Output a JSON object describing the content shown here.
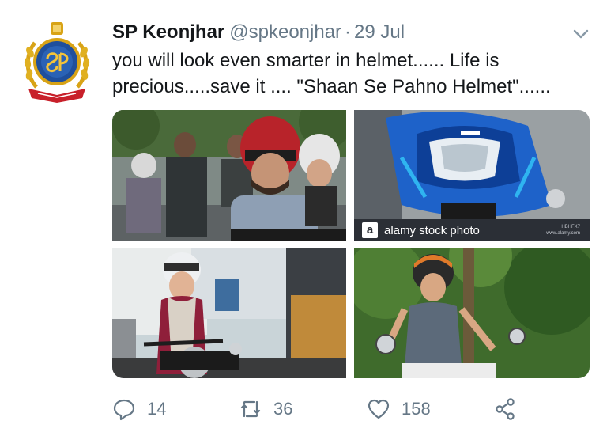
{
  "tweet": {
    "display_name": "SP Keonjhar",
    "handle": "@spkeonjhar",
    "separator": "·",
    "date": "29 Jul",
    "text": "you will look even smarter in helmet...... Life is precious.....save it .... \"Shaan Se Pahno Helmet\"......"
  },
  "media": {
    "watermark": {
      "logo_letter": "a",
      "brand": "alamy stock photo",
      "image_id": "HBHFX7",
      "site": "www.alamy.com"
    }
  },
  "actions": {
    "reply_count": "14",
    "retweet_count": "36",
    "like_count": "158"
  },
  "icons": {
    "avatar": "police-emblem-icon",
    "caret": "chevron-down-icon",
    "reply": "reply-icon",
    "retweet": "retweet-icon",
    "like": "heart-icon",
    "share": "share-icon"
  },
  "colors": {
    "text_primary": "#14171a",
    "text_secondary": "#657786",
    "emblem_blue": "#1f4f9c",
    "emblem_red": "#c8202a",
    "emblem_gold": "#d8a316"
  }
}
